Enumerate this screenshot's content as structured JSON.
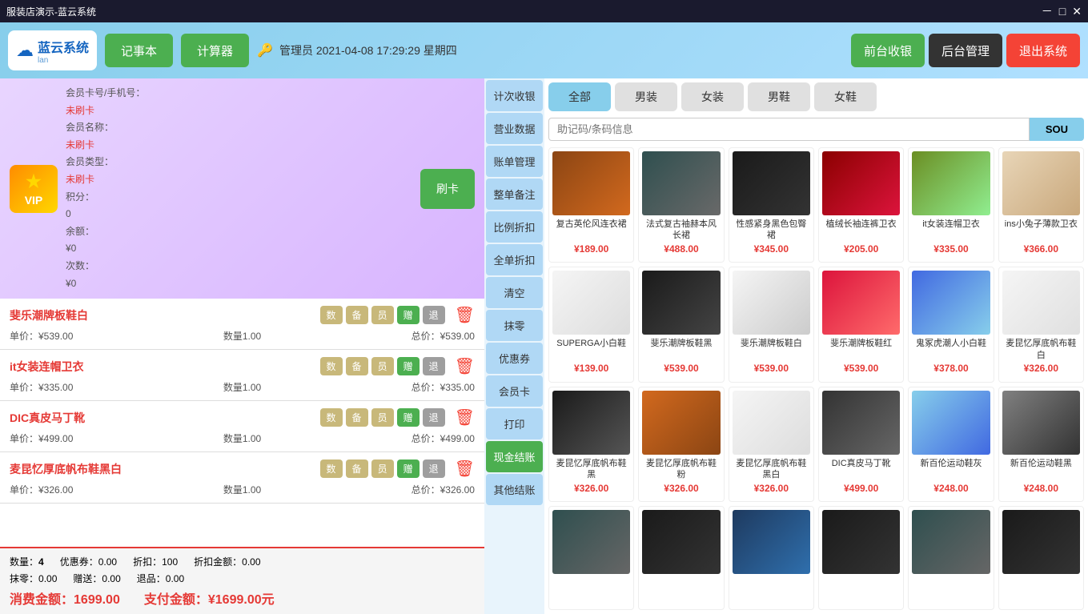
{
  "titlebar": {
    "title": "服装店演示-蓝云系统",
    "minimize": "－",
    "maximize": "□",
    "close": "✕"
  },
  "header": {
    "logo_text": "蓝云系统",
    "logo_sub": "lan",
    "btn_notebook": "记事本",
    "btn_calculator": "计算器",
    "admin_info": "管理员 2021-04-08  17:29:29  星期四",
    "btn_front": "前台收银",
    "btn_back": "后台管理",
    "btn_exit": "退出系统"
  },
  "member": {
    "card_label": "会员卡号/手机号：",
    "card_value": "未刷卡",
    "name_label": "会员名称：",
    "name_value": "未刷卡",
    "type_label": "会员类型：",
    "type_value": "未刷卡",
    "points_label": "积分：",
    "points_value": "0",
    "balance_label": "余额：",
    "balance_value": "¥0",
    "times_label": "次数：",
    "times_value": "¥0",
    "vip_text": "VIP",
    "scan_btn": "刷卡"
  },
  "cart": {
    "items": [
      {
        "name": "斐乐潮牌板鞋白",
        "unit_price": "¥539.00",
        "quantity": "1.00",
        "total": "¥539.00",
        "btns": [
          "数",
          "备",
          "员",
          "赠",
          "退"
        ]
      },
      {
        "name": "it女装连帽卫衣",
        "unit_price": "¥335.00",
        "quantity": "1.00",
        "total": "¥335.00",
        "btns": [
          "数",
          "备",
          "员",
          "赠",
          "退"
        ]
      },
      {
        "name": "DIC真皮马丁靴",
        "unit_price": "¥499.00",
        "quantity": "1.00",
        "total": "¥499.00",
        "btns": [
          "数",
          "备",
          "员",
          "赠",
          "退"
        ]
      },
      {
        "name": "麦昆忆厚底帆布鞋黑白",
        "unit_price": "¥326.00",
        "quantity": "1.00",
        "total": "¥326.00",
        "btns": [
          "数",
          "备",
          "员",
          "赠",
          "退"
        ]
      }
    ],
    "unit_price_label": "单价：",
    "quantity_label": "数量",
    "total_label": "总价："
  },
  "summary": {
    "quantity_label": "数量：",
    "quantity_value": "4",
    "coupon_label": "优惠券：",
    "coupon_value": "0.00",
    "discount_label": "折扣：",
    "discount_value": "100",
    "discount_amount_label": "折扣金额：",
    "discount_amount_value": "0.00",
    "erase_label": "抹零：",
    "erase_value": "0.00",
    "gift_label": "赠送：",
    "gift_value": "0.00",
    "return_label": "退品：",
    "return_value": "0.00",
    "consume_label": "消费金额：",
    "consume_value": "1699.00",
    "pay_label": "支付金额：",
    "pay_value": "¥1699.00元"
  },
  "nav": {
    "items": [
      "计次收银",
      "营业数据",
      "账单管理",
      "整单备注",
      "比例折扣",
      "全单折扣",
      "清空",
      "抹零",
      "优惠券",
      "会员卡",
      "打印",
      "现金结账",
      "其他结账"
    ]
  },
  "right": {
    "search_placeholder": "助记码/条码信息",
    "search_btn": "SOU",
    "categories": [
      "全部",
      "男装",
      "女装",
      "男鞋",
      "女鞋"
    ],
    "active_category": "全部",
    "products": [
      {
        "name": "复古英伦风连衣裙",
        "price": "¥189.00",
        "img_class": "img-dress1"
      },
      {
        "name": "法式复古袖赫本风长裙",
        "price": "¥488.00",
        "img_class": "img-dress2"
      },
      {
        "name": "性感紧身黑色包臀裙",
        "price": "¥345.00",
        "img_class": "img-dress3"
      },
      {
        "name": "植绒长袖连裤卫衣",
        "price": "¥205.00",
        "img_class": "img-dress4"
      },
      {
        "name": "it女装连帽卫衣",
        "price": "¥335.00",
        "img_class": "img-dress5"
      },
      {
        "name": "ins小兔子薄款卫衣",
        "price": "¥366.00",
        "img_class": "img-dress6"
      },
      {
        "name": "SUPERGA小白鞋",
        "price": "¥139.00",
        "img_class": "img-shoe1"
      },
      {
        "name": "斐乐潮牌板鞋黑",
        "price": "¥539.00",
        "img_class": "img-shoe2"
      },
      {
        "name": "斐乐潮牌板鞋白",
        "price": "¥539.00",
        "img_class": "img-shoe3"
      },
      {
        "name": "斐乐潮牌板鞋红",
        "price": "¥539.00",
        "img_class": "img-shoe4"
      },
      {
        "name": "鬼冢虎潮人小白鞋",
        "price": "¥378.00",
        "img_class": "img-shoe5"
      },
      {
        "name": "麦昆忆厚底帆布鞋白",
        "price": "¥326.00",
        "img_class": "img-shoe6"
      },
      {
        "name": "麦昆忆厚底帆布鞋黑",
        "price": "¥326.00",
        "img_class": "img-shoe7"
      },
      {
        "name": "麦昆忆厚底帆布鞋粉",
        "price": "¥326.00",
        "img_class": "img-shoe8"
      },
      {
        "name": "麦昆忆厚底帆布鞋黑白",
        "price": "¥326.00",
        "img_class": "img-shoe9"
      },
      {
        "name": "DIC真皮马丁靴",
        "price": "¥499.00",
        "img_class": "img-shoe10"
      },
      {
        "name": "新百伦运动鞋灰",
        "price": "¥248.00",
        "img_class": "img-shoe11"
      },
      {
        "name": "新百伦运动鞋黑",
        "price": "¥248.00",
        "img_class": "img-shoe12"
      },
      {
        "name": "",
        "price": "",
        "img_class": "img-shoe13"
      },
      {
        "name": "",
        "price": "",
        "img_class": "img-shoe14"
      },
      {
        "name": "",
        "price": "",
        "img_class": "img-shoe15"
      },
      {
        "name": "",
        "price": "",
        "img_class": "img-shoe16"
      },
      {
        "name": "",
        "price": "",
        "img_class": "img-shoe13"
      },
      {
        "name": "",
        "price": "",
        "img_class": "img-shoe14"
      }
    ]
  }
}
